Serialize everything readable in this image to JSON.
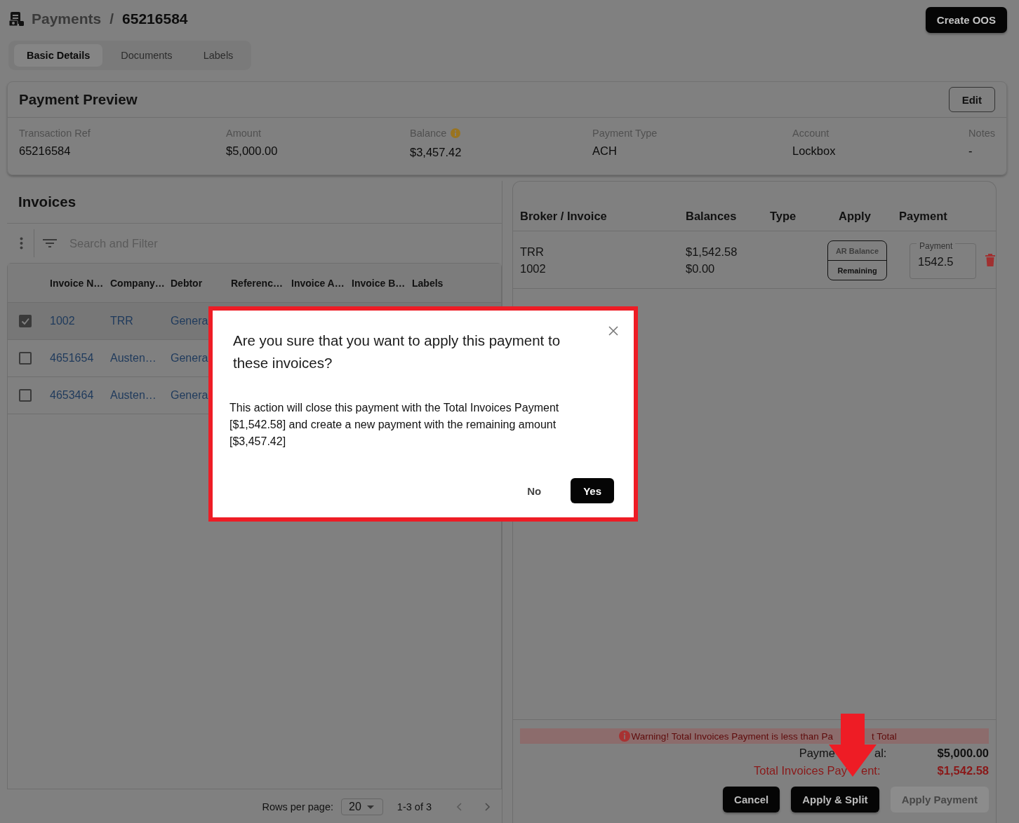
{
  "header": {
    "section": "Payments",
    "separator": "/",
    "record": "65216584",
    "action_button": "Create OOS"
  },
  "tabs": [
    {
      "label": "Basic Details",
      "selected": true
    },
    {
      "label": "Documents",
      "selected": false
    },
    {
      "label": "Labels",
      "selected": false
    }
  ],
  "payment_preview": {
    "title": "Payment Preview",
    "edit_button": "Edit",
    "fields": [
      {
        "label": "Transaction Ref",
        "value": "65216584",
        "info": false
      },
      {
        "label": "Amount",
        "value": "$5,000.00",
        "info": false
      },
      {
        "label": "Balance",
        "value": "$3,457.42",
        "info": true
      },
      {
        "label": "Payment Type",
        "value": "ACH",
        "info": false
      },
      {
        "label": "Account",
        "value": "Lockbox",
        "info": false
      },
      {
        "label": "Notes",
        "value": "-",
        "info": false
      }
    ]
  },
  "invoices": {
    "title": "Invoices",
    "search": {
      "placeholder": "Search and Filter"
    },
    "columns": [
      "Invoice N…",
      "Company…",
      "Debtor",
      "Referenc…",
      "Invoice A…",
      "Invoice B…",
      "Labels"
    ],
    "rows": [
      {
        "checked": true,
        "cells": [
          "1002",
          "TRR",
          "Genera"
        ]
      },
      {
        "checked": false,
        "cells": [
          "4651654",
          "Austen…",
          "Genera"
        ]
      },
      {
        "checked": false,
        "cells": [
          "4653464",
          "Austen…",
          "Genera"
        ]
      }
    ],
    "pagination": {
      "rows_per_page_label": "Rows per page:",
      "rows_per_page": "20",
      "range": "1-3 of 3"
    }
  },
  "apply_panel": {
    "columns": [
      "Broker / Invoice",
      "Balances",
      "Type",
      "Apply",
      "Payment"
    ],
    "rows": [
      {
        "broker": "TRR",
        "invoice": "1002",
        "balance": "$1,542.58",
        "remaining": "$0.00",
        "apply_options": [
          {
            "label": "AR Balance",
            "selected": false
          },
          {
            "label": "Remaining",
            "selected": true
          }
        ],
        "payment": {
          "label": "Payment",
          "value": "1542.5"
        }
      }
    ],
    "warning": [
      "Warning! Total Invoices Payment is less than Pa",
      "t Total"
    ],
    "totals": [
      {
        "label": [
          "Payme",
          "al:"
        ],
        "value": "$5,000.00",
        "alert": false
      },
      {
        "label": [
          "Total Invoices Pay",
          "ent:"
        ],
        "value": "$1,542.58",
        "alert": true
      }
    ],
    "buttons": [
      {
        "label": "Cancel",
        "disabled": false
      },
      {
        "label": "Apply & Split",
        "disabled": false
      },
      {
        "label": "Apply Payment",
        "disabled": true
      }
    ]
  },
  "dialog": {
    "title": "Are you sure that you want to apply this payment to these invoices?",
    "message": "This action will close this payment with the Total Invoices Payment [$1,542.58] and create a new payment with the remaining amount [$3,457.42]",
    "buttons": [
      {
        "label": "No",
        "kind": "text"
      },
      {
        "label": "Yes",
        "kind": "contained"
      }
    ]
  }
}
